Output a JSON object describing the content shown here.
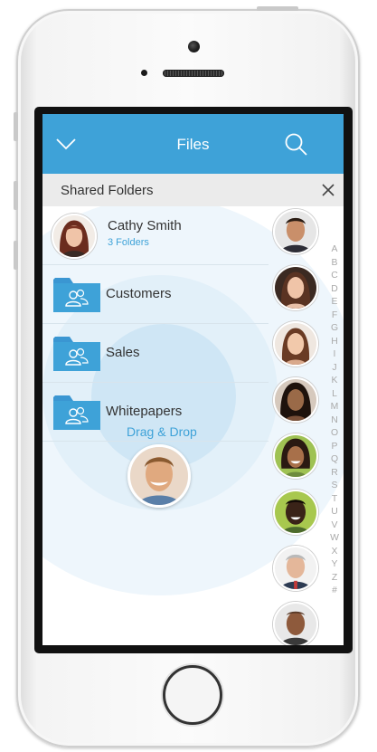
{
  "navbar": {
    "title": "Files",
    "back_icon": "chevron-down-icon",
    "search_icon": "search-icon",
    "color": "#3ea2d8"
  },
  "subheader": {
    "title": "Shared Folders",
    "close_icon": "close-icon"
  },
  "shared_user": {
    "name": "Cathy Smith",
    "count": "3 Folders"
  },
  "folders": [
    {
      "label": "Customers",
      "icon": "shared-folder-icon"
    },
    {
      "label": "Sales",
      "icon": "shared-folder-icon"
    },
    {
      "label": "Whitepapers",
      "icon": "shared-folder-icon"
    }
  ],
  "drag": {
    "label": "Drag & Drop"
  },
  "contacts_count": 8,
  "alphabet": [
    "A",
    "B",
    "C",
    "D",
    "E",
    "F",
    "G",
    "H",
    "I",
    "J",
    "K",
    "L",
    "M",
    "N",
    "O",
    "P",
    "Q",
    "R",
    "S",
    "T",
    "U",
    "V",
    "W",
    "X",
    "Y",
    "Z",
    "#"
  ],
  "colors": {
    "accent": "#3ea2d8",
    "ring": "#e9f4fb"
  }
}
